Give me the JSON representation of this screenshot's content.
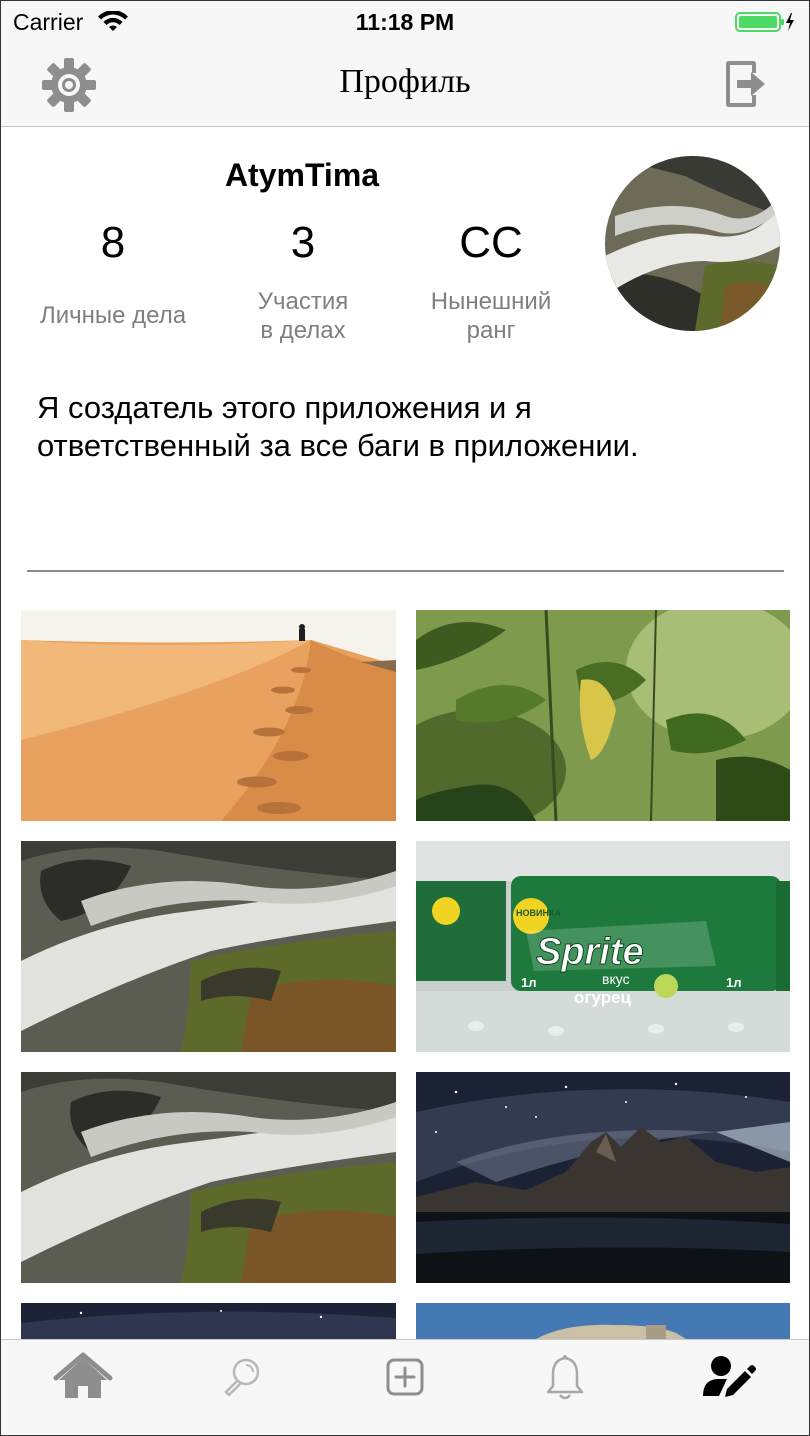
{
  "status_bar": {
    "carrier": "Carrier",
    "time": "11:18 PM",
    "battery_color": "#4cd964"
  },
  "nav": {
    "title": "Профиль",
    "left_icon": "gear-icon",
    "right_icon": "logout-icon"
  },
  "profile": {
    "username": "AtymTima",
    "stats": [
      {
        "value": "8",
        "label_line1": "Личные дела",
        "label_line2": ""
      },
      {
        "value": "3",
        "label_line1": "Участия",
        "label_line2": "в делах"
      },
      {
        "value": "CC",
        "label_line1": "Нынешний",
        "label_line2": "ранг"
      }
    ],
    "bio_line1": "Я создатель этого приложения и я",
    "bio_line2": "ответственный за все баги в приложении.",
    "avatar_subject": "waterfall"
  },
  "photos": [
    {
      "subject": "desert-dunes"
    },
    {
      "subject": "green-leaves"
    },
    {
      "subject": "waterfall"
    },
    {
      "subject": "sprite-bottles",
      "text_brand": "Sprite",
      "text_taste": "вкус",
      "text_flavor": "огурец",
      "text_new": "НОВИНКА",
      "text_volume": "1л"
    },
    {
      "subject": "waterfall"
    },
    {
      "subject": "night-mountains"
    },
    {
      "subject": "night-sky"
    },
    {
      "subject": "rock-sky"
    }
  ],
  "tabs": [
    {
      "icon": "home-icon",
      "active": false
    },
    {
      "icon": "search-icon",
      "active": false
    },
    {
      "icon": "add-icon",
      "active": false
    },
    {
      "icon": "bell-icon",
      "active": false
    },
    {
      "icon": "user-edit-icon",
      "active": true
    }
  ],
  "colors": {
    "icon_inactive": "#8e8e8e",
    "icon_active": "#000000",
    "label_gray": "#7f7f7f"
  }
}
